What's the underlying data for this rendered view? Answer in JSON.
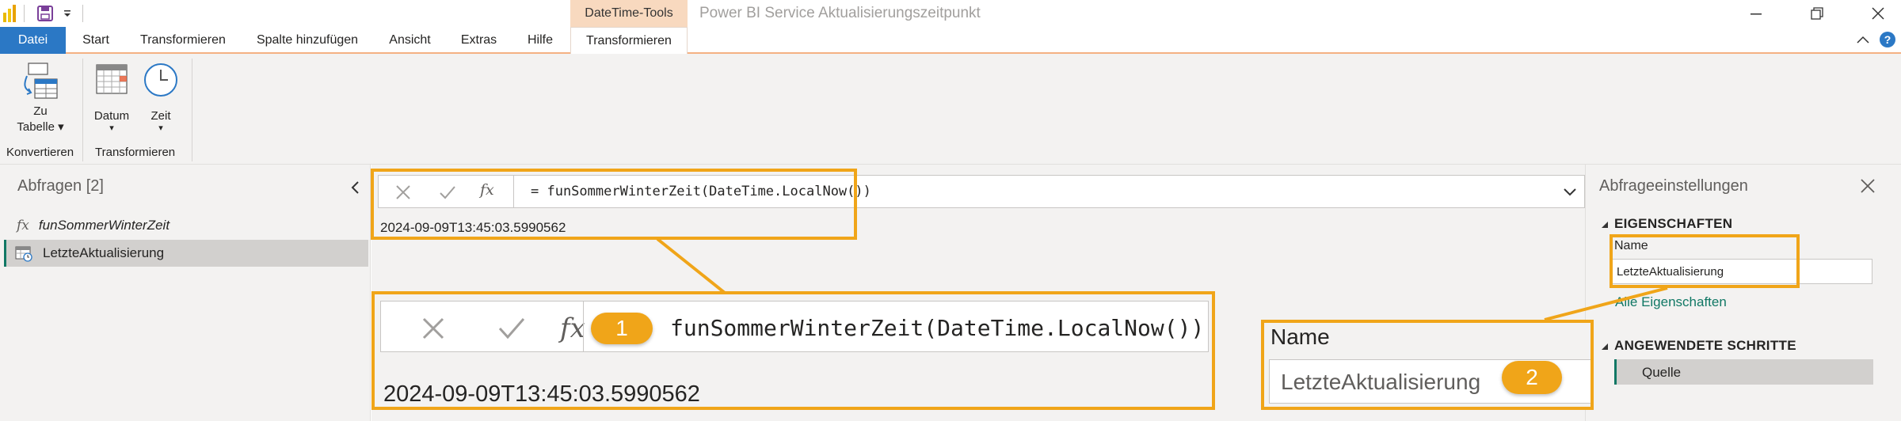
{
  "titlebar": {
    "context_tab": "DateTime-Tools",
    "app_title": "Power BI Service Aktualisierungszeitpunkt"
  },
  "tabs": {
    "items": [
      "Datei",
      "Start",
      "Transformieren",
      "Spalte hinzufügen",
      "Ansicht",
      "Extras",
      "Hilfe",
      "Transformieren"
    ]
  },
  "ribbon": {
    "zu_tabelle_line1": "Zu",
    "zu_tabelle_line2": "Tabelle",
    "datum": "Datum",
    "zeit": "Zeit",
    "group_konvertieren": "Konvertieren",
    "group_transformieren": "Transformieren"
  },
  "left_pane": {
    "title": "Abfragen [2]",
    "queries": [
      "funSommerWinterZeit",
      "LetzteAktualisierung"
    ]
  },
  "formula_bar": {
    "formula": "= funSommerWinterZeit(DateTime.LocalNow())",
    "fx": "fx"
  },
  "result": {
    "value": "2024-09-09T13:45:03.5990562"
  },
  "zoom1": {
    "formula": "funSommerWinterZeit(DateTime.LocalNow())",
    "value": "2024-09-09T13:45:03.5990562",
    "fx": "fx",
    "badge": "1"
  },
  "zoom2": {
    "label": "Name",
    "value": "LetzteAktualisierung",
    "badge": "2"
  },
  "right_pane": {
    "title": "Abfrageeinstellungen",
    "properties_header": "EIGENSCHAFTEN",
    "name_label": "Name",
    "name_value": "LetzteAktualisierung",
    "all_properties_link": "Alle Eigenschaften",
    "steps_header": "ANGEWENDETE SCHRITTE",
    "steps": [
      "Quelle"
    ]
  },
  "colors": {
    "accent_file_tab": "#2b78c5",
    "highlight": "#f0a519",
    "context_tab": "#f8d9bf",
    "link": "#117865"
  }
}
